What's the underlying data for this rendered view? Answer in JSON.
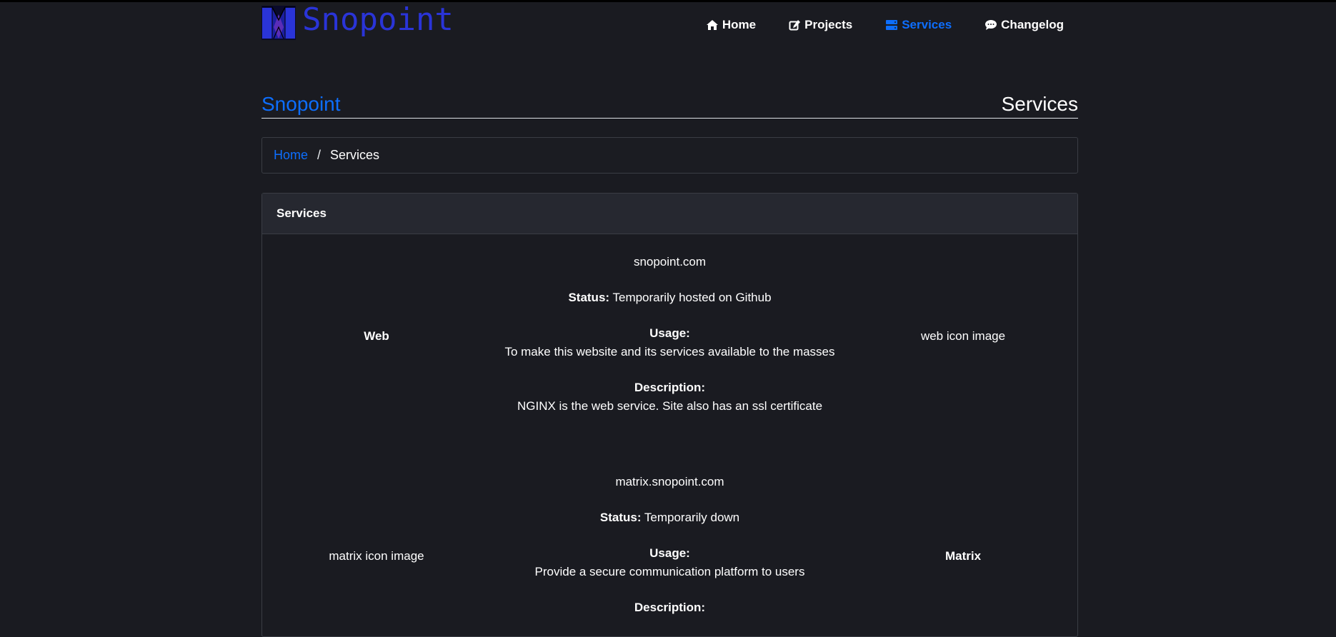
{
  "header": {
    "brand": "Snopoint",
    "nav": [
      {
        "label": "Home",
        "icon": "home-icon"
      },
      {
        "label": "Projects",
        "icon": "edit-icon"
      },
      {
        "label": "Services",
        "icon": "server-icon",
        "active": true
      },
      {
        "label": "Changelog",
        "icon": "comment-icon"
      }
    ]
  },
  "title_row": {
    "site": "Snopoint",
    "page": "Services"
  },
  "breadcrumb": {
    "home": "Home",
    "separator": "/",
    "current": "Services"
  },
  "card": {
    "header": "Services",
    "services": [
      {
        "name": "Web",
        "domain": "snopoint.com",
        "status_label": "Status:",
        "status": "Temporarily hosted on Github",
        "usage_label": "Usage:",
        "usage": "To make this website and its services available to the masses",
        "description_label": "Description:",
        "description": "NGINX is the web service. Site also has an ssl certificate",
        "image_alt": "web icon image"
      },
      {
        "name": "Matrix",
        "domain": "matrix.snopoint.com",
        "status_label": "Status:",
        "status": "Temporarily down",
        "usage_label": "Usage:",
        "usage": "Provide a secure communication platform to users",
        "description_label": "Description:",
        "image_alt": "matrix icon image"
      }
    ]
  },
  "colors": {
    "background": "#1a1b21",
    "accent": "#0d6efd",
    "brand": "#2a34d8",
    "card_header": "#262830"
  }
}
